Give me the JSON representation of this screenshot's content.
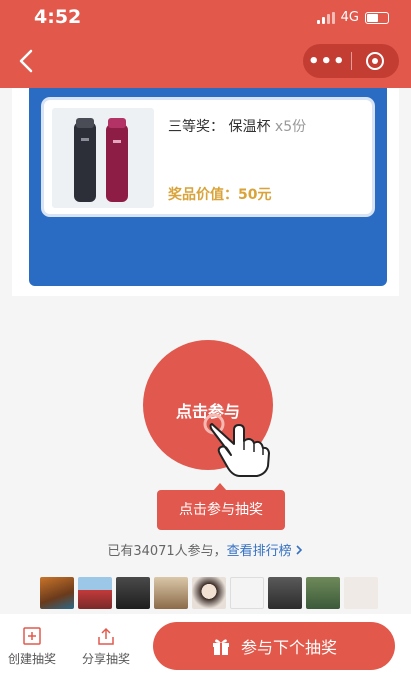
{
  "status_bar": {
    "time": "4:52",
    "network": "4G"
  },
  "prize": {
    "rank_label": "三等奖：",
    "name": "保温杯",
    "quantity": "x5份",
    "value_label": "奖品价值：",
    "value": "50元"
  },
  "join": {
    "button_label": "点击参与",
    "tooltip": "点击参与抽奖",
    "participants_text": "已有34071人参与，",
    "leaderboard_link": "查看排行榜"
  },
  "bottom_bar": {
    "create_label": "创建抽奖",
    "share_label": "分享抽奖",
    "next_label": "参与下个抽奖"
  },
  "colors": {
    "brand_red": "#e2584b",
    "prize_blue": "#2a6bc4",
    "value_gold": "#d9a33a",
    "link_blue": "#3570c4"
  },
  "icons": [
    "back-icon",
    "more-icon",
    "close-miniprogram-icon",
    "hand-pointer-icon",
    "add-icon",
    "share-icon",
    "gift-icon",
    "chevron-right-icon"
  ]
}
